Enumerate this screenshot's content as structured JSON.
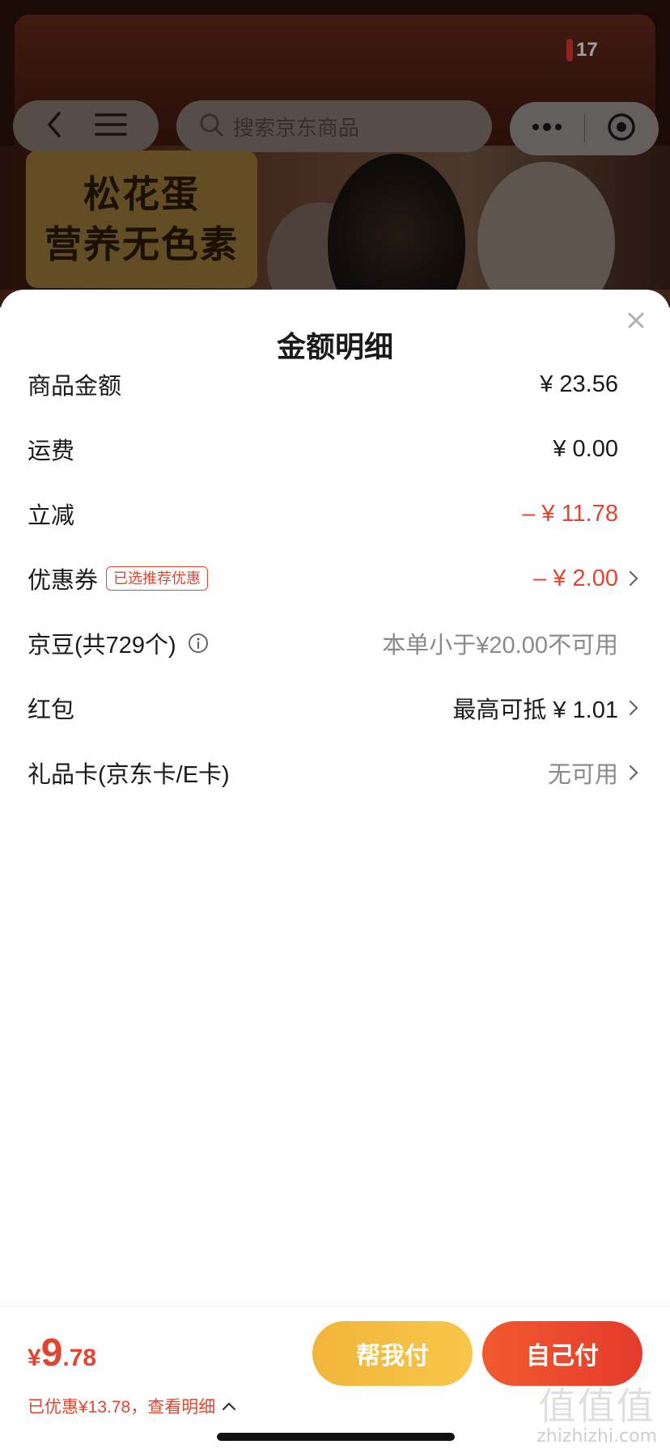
{
  "background": {
    "promo_line1": "松花蛋",
    "promo_line2": "营养无色素",
    "badge_count": "17",
    "search_placeholder": "搜索京东商品",
    "icons": [
      "back-icon",
      "menu-icon",
      "search-icon",
      "more-dots-icon",
      "target-icon"
    ]
  },
  "sheet": {
    "title": "金额明细",
    "close_icon": "close-icon",
    "rows": [
      {
        "label": "商品金额",
        "value": "¥ 23.56",
        "style": "normal",
        "chevron": false
      },
      {
        "label": "运费",
        "value": "¥ 0.00",
        "style": "normal",
        "chevron": false
      },
      {
        "label": "立减",
        "value": "– ¥ 11.78",
        "style": "red",
        "chevron": false
      },
      {
        "label": "优惠券",
        "tag": "已选推荐优惠",
        "value": "– ¥ 2.00",
        "style": "red",
        "chevron": true
      },
      {
        "label": "京豆(共729个)",
        "info_icon": "info-icon",
        "value": "本单小于¥20.00不可用",
        "style": "gray",
        "chevron": false
      },
      {
        "label": "红包",
        "value": "最高可抵 ¥ 1.01",
        "style": "normal",
        "chevron": true
      },
      {
        "label": "礼品卡(京东卡/E卡)",
        "value": "无可用",
        "style": "gray",
        "chevron": true
      }
    ]
  },
  "bottom_bar": {
    "price_symbol": "¥",
    "price_int": "9",
    "price_dec": ".78",
    "saved_text": "已优惠¥13.78，查看明细",
    "help_pay_label": "帮我付",
    "self_pay_label": "自己付"
  },
  "watermark": {
    "big": "值值值",
    "small": "zhizhizhi.com"
  },
  "colors": {
    "accent_red": "#e2452f",
    "button_yellow": "#f3bc42",
    "button_red": "#e9462d",
    "muted_gray": "#8a8a8a"
  }
}
